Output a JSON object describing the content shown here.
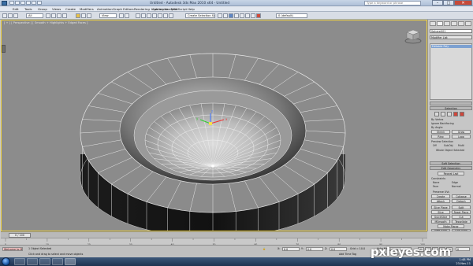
{
  "window": {
    "title": "Untitled - Autodesk 3ds Max 2010 x64 - Untitled",
    "search_placeholder": "Type a keyword or phrase"
  },
  "menu": [
    "Edit",
    "Tools",
    "Group",
    "Views",
    "Create",
    "Modifiers",
    "Animation",
    "Graph Editors",
    "Rendering",
    "Lighting Analysis",
    "Customize",
    "MAXScript",
    "Help"
  ],
  "toolbar": {
    "filter_value": "All",
    "view_value": "View",
    "selection_set_placeholder": "Create Selection Se",
    "layer_value": "0 (default)"
  },
  "viewport": {
    "label": "[ + ] [ Perspective ] [ Smooth + Highlights + Edged Faces ]"
  },
  "command_panel": {
    "object_name": "Sphere001",
    "modifier_list": "Modifier List",
    "stack_item": "Editable Poly",
    "selection_title": "Selection",
    "by_vertex": "By Vertex",
    "ignore_backfacing": "Ignore Backfacing",
    "by_angle": "By Angle:",
    "shrink": "Shrink",
    "grow": "Grow",
    "ring": "Ring",
    "loop": "Loop",
    "preview_selection": "Preview Selection",
    "off": "Off",
    "subobj": "SubObj",
    "multi": "Multi",
    "whole_selected": "Whole Object Selected",
    "soft_selection": "Soft Selection",
    "edit_geometry": "Edit Geometry",
    "repeat_last": "Repeat Last",
    "constraints": "Constraints",
    "none": "None",
    "edge": "Edge",
    "face": "Face",
    "normal": "Normal",
    "preserve_uvs": "Preserve UVs",
    "create": "Create",
    "collapse": "Collapse",
    "attach": "Attach",
    "detach": "Detach",
    "slice_plane": "Slice Plane",
    "split": "Split",
    "slice": "Slice",
    "reset_plane": "Reset Plane",
    "quickslice": "QuickSlice",
    "cut": "Cut",
    "msmooth": "MSmooth",
    "tessellate": "Tessellate",
    "make_planar": "Make Planar",
    "view_align": "View Align",
    "grid_align": "Grid Align",
    "relax": "Relax"
  },
  "timeline": {
    "frame_display": "0 / 100",
    "ticks": [
      "0",
      "10",
      "20",
      "30",
      "40",
      "50",
      "60",
      "70",
      "80",
      "90",
      "100"
    ]
  },
  "status": {
    "listener": "Welcome to M",
    "objects_selected": "1 Object Selected",
    "prompt": "Click and drag to select and move objects",
    "x_value": "0.0",
    "y_value": "0.0",
    "z_value": "0.0",
    "grid": "Grid = 10.0",
    "auto_key": "Auto Key",
    "selected": "Selected",
    "set_key": "Set Key",
    "key_filters": "Key Filters...",
    "add_time_tag": "Add Time Tag",
    "frame": "0"
  },
  "taskbar": {
    "time": "1:48 PM",
    "date": "23-Nov-11"
  },
  "watermark": "pxleyes.com",
  "colors": {
    "viewport_border": "#f2d440",
    "selection_blue": "#7da1d1",
    "close_red": "#c64a3a"
  }
}
